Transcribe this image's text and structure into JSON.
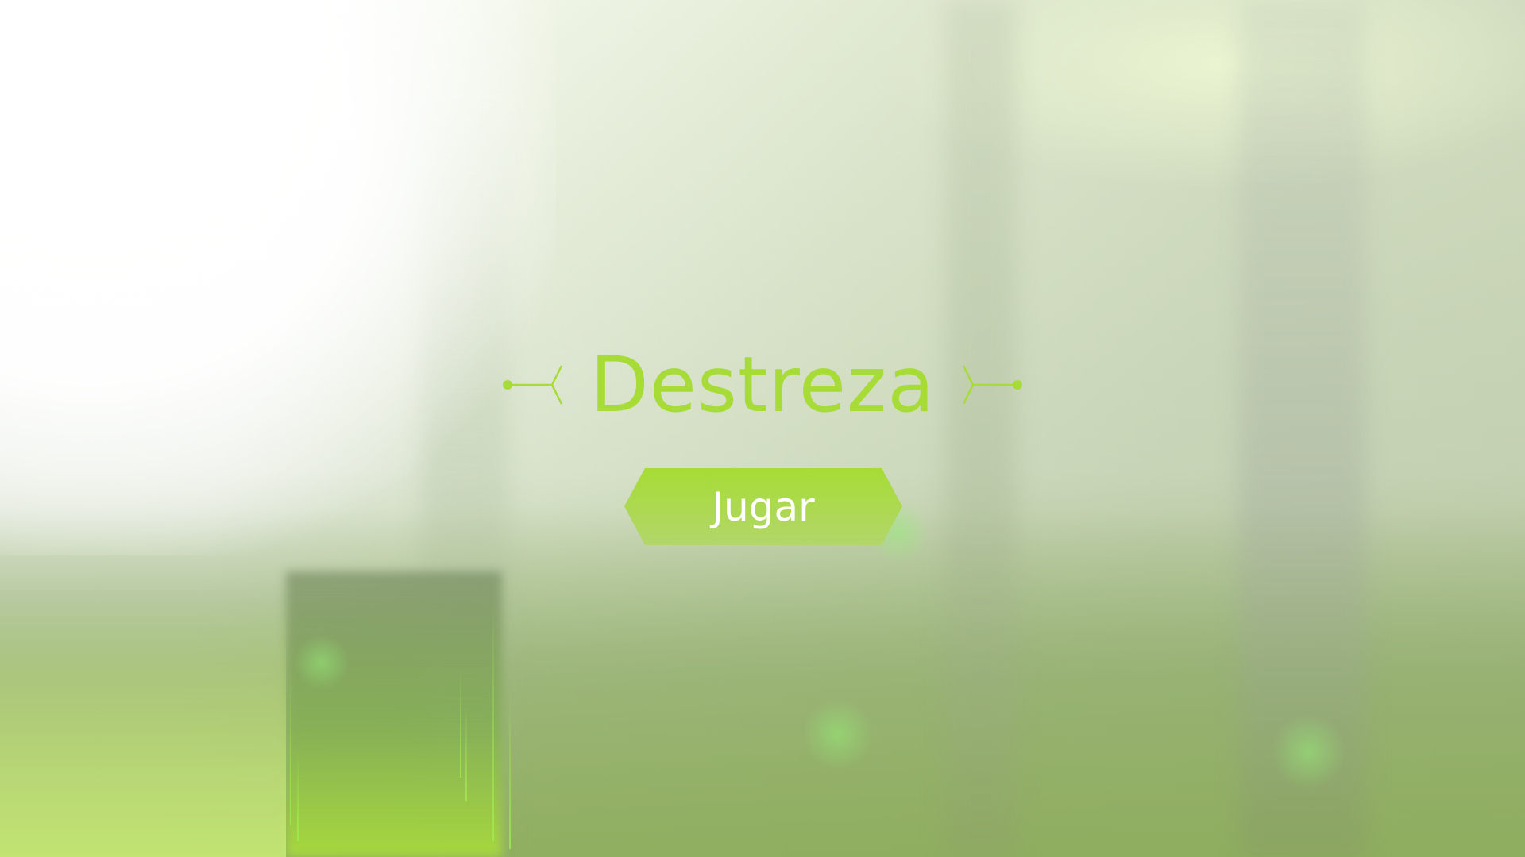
{
  "game": {
    "title": "Destreza",
    "play_label": "Jugar"
  },
  "colors": {
    "accent": "#a6dc35",
    "button_top": "#a6dc35",
    "button_bottom": "#b2d66a",
    "button_text": "#ffffff"
  },
  "icons": {
    "title_left": "connector-ornament-icon",
    "title_right": "connector-ornament-icon"
  }
}
